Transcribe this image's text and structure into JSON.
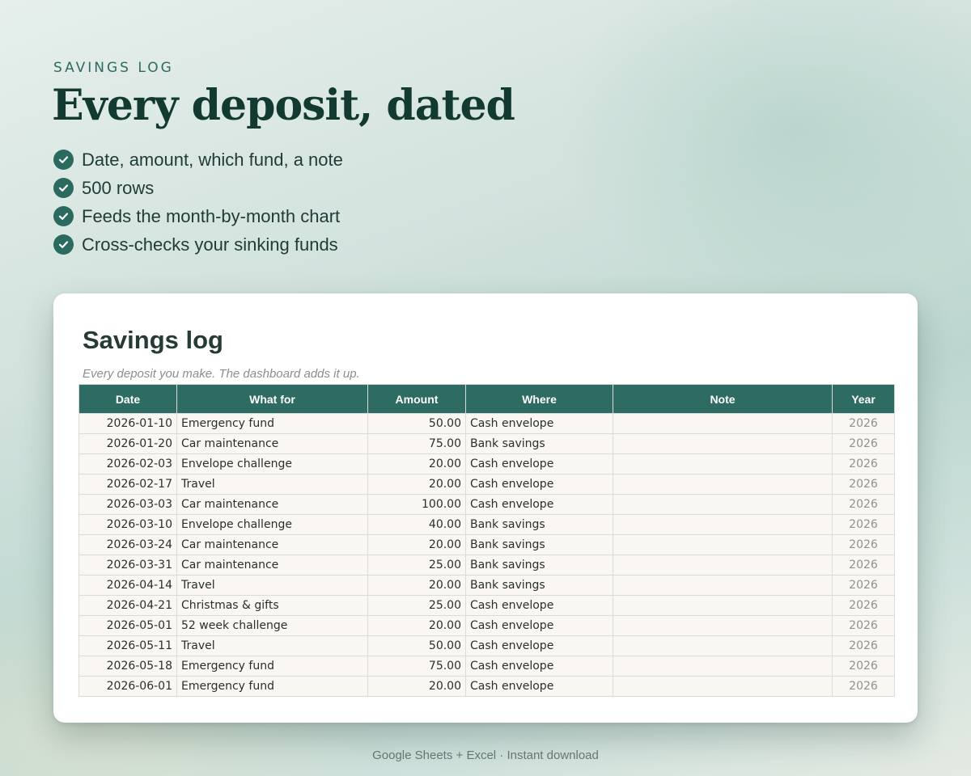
{
  "header": {
    "eyebrow": "SAVINGS LOG",
    "headline": "Every deposit, dated",
    "bullets": [
      "Date, amount, which fund, a note",
      "500 rows",
      "Feeds the month-by-month chart",
      "Cross-checks your sinking funds"
    ]
  },
  "sheet": {
    "title": "Savings log",
    "subtitle": "Every deposit you make. The dashboard adds it up.",
    "columns": [
      "Date",
      "What for",
      "Amount",
      "Where",
      "Note",
      "Year"
    ],
    "rows": [
      [
        "2026-01-10",
        "Emergency fund",
        "50.00",
        "Cash envelope",
        "",
        "2026"
      ],
      [
        "2026-01-20",
        "Car maintenance",
        "75.00",
        "Bank savings",
        "",
        "2026"
      ],
      [
        "2026-02-03",
        "Envelope challenge",
        "20.00",
        "Cash envelope",
        "",
        "2026"
      ],
      [
        "2026-02-17",
        "Travel",
        "20.00",
        "Cash envelope",
        "",
        "2026"
      ],
      [
        "2026-03-03",
        "Car maintenance",
        "100.00",
        "Cash envelope",
        "",
        "2026"
      ],
      [
        "2026-03-10",
        "Envelope challenge",
        "40.00",
        "Bank savings",
        "",
        "2026"
      ],
      [
        "2026-03-24",
        "Car maintenance",
        "20.00",
        "Bank savings",
        "",
        "2026"
      ],
      [
        "2026-03-31",
        "Car maintenance",
        "25.00",
        "Bank savings",
        "",
        "2026"
      ],
      [
        "2026-04-14",
        "Travel",
        "20.00",
        "Bank savings",
        "",
        "2026"
      ],
      [
        "2026-04-21",
        "Christmas & gifts",
        "25.00",
        "Cash envelope",
        "",
        "2026"
      ],
      [
        "2026-05-01",
        "52 week challenge",
        "20.00",
        "Cash envelope",
        "",
        "2026"
      ],
      [
        "2026-05-11",
        "Travel",
        "50.00",
        "Cash envelope",
        "",
        "2026"
      ],
      [
        "2026-05-18",
        "Emergency fund",
        "75.00",
        "Cash envelope",
        "",
        "2026"
      ],
      [
        "2026-06-01",
        "Emergency fund",
        "20.00",
        "Cash envelope",
        "",
        "2026"
      ]
    ]
  },
  "footer": {
    "text": "Google Sheets + Excel  ·  Instant download"
  },
  "colors": {
    "accent": "#2e6b62",
    "headline": "#123a31",
    "row_fill": "#faf6f1"
  },
  "icons": {
    "bullet": "check-circle-icon"
  }
}
